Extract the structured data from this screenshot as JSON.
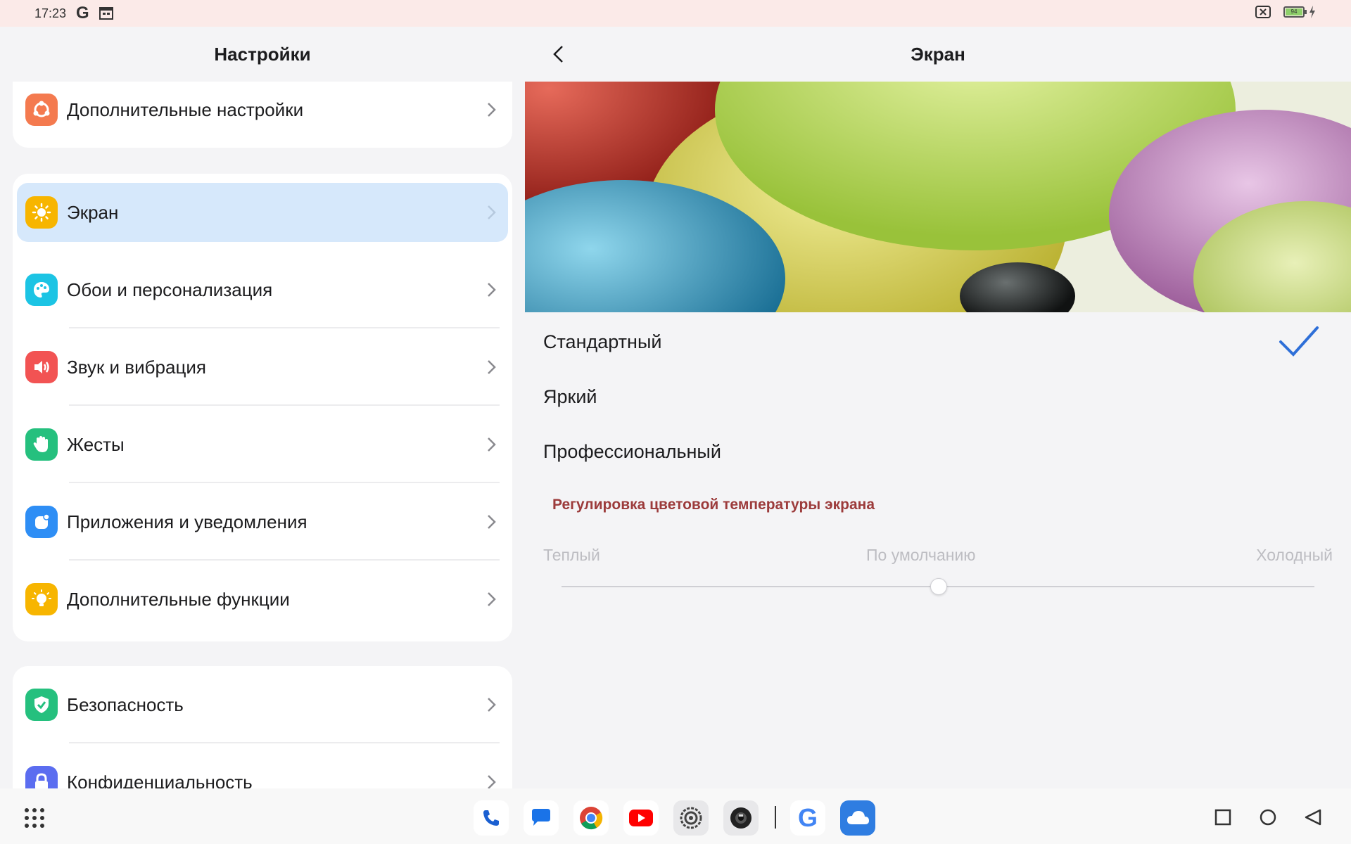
{
  "status_bar": {
    "time": "17:23",
    "google_letter": "G",
    "battery_level": "94"
  },
  "left_panel": {
    "title": "Настройки",
    "group1": [
      {
        "label": "Дополнительные настройки",
        "icon": "more-settings-icon",
        "color": "#f47a4f"
      }
    ],
    "group2": [
      {
        "label": "Экран",
        "icon": "sun-icon",
        "color": "#f7b500",
        "selected": true
      },
      {
        "label": "Обои и персонализация",
        "icon": "palette-icon",
        "color": "#1cc4e4"
      },
      {
        "label": "Звук и вибрация",
        "icon": "speaker-icon",
        "color": "#f25353"
      },
      {
        "label": "Жесты",
        "icon": "hand-icon",
        "color": "#25c07e"
      },
      {
        "label": "Приложения и уведомления",
        "icon": "apps-icon",
        "color": "#2e8ef5"
      },
      {
        "label": "Дополнительные функции",
        "icon": "bulb-icon",
        "color": "#f7b500"
      }
    ],
    "group3": [
      {
        "label": "Безопасность",
        "icon": "shield-icon",
        "color": "#25c07e"
      },
      {
        "label": "Конфиденциальность",
        "icon": "lock-icon",
        "color": "#5b6df0"
      }
    ]
  },
  "right_panel": {
    "title": "Экран",
    "modes": [
      {
        "label": "Стандартный",
        "selected": true
      },
      {
        "label": "Яркий",
        "selected": false
      },
      {
        "label": "Профессиональный",
        "selected": false
      }
    ],
    "color_temp": {
      "title": "Регулировка цветовой температуры экрана",
      "warm": "Теплый",
      "default": "По умолчанию",
      "cold": "Холодный",
      "value_fraction": 0.5
    }
  },
  "taskbar": {
    "apps": [
      "phone-app-icon",
      "messages-app-icon",
      "chrome-app-icon",
      "youtube-app-icon",
      "settings-app-icon",
      "camera-app-icon",
      "google-app-icon",
      "cloud-app-icon"
    ],
    "google_letter": "G"
  },
  "colors": {
    "accent": "#2e6fd8",
    "selected_bg": "#d6e8fb",
    "section_title": "#9c3b3b"
  }
}
